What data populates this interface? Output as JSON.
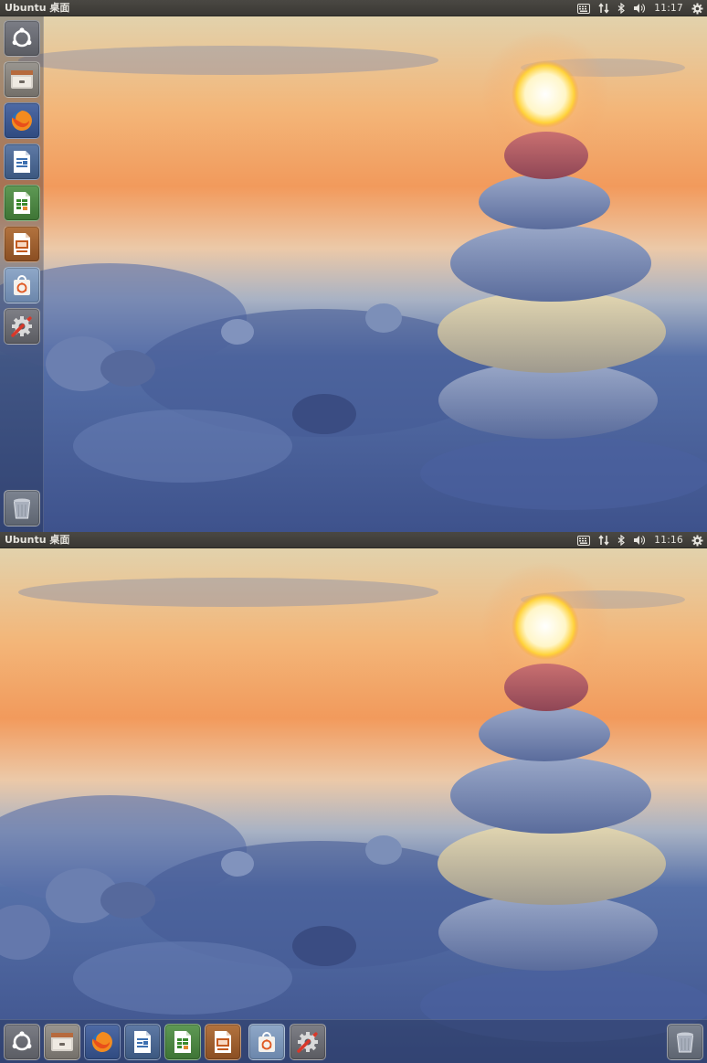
{
  "screens": [
    {
      "id": "top",
      "panel": {
        "title": "Ubuntu 桌面",
        "clock": "11:17",
        "indicators": [
          "keyboard-icon",
          "network-icon",
          "bluetooth-icon",
          "volume-icon",
          "clock",
          "settings-gear-icon"
        ]
      },
      "launcher": {
        "position": "left",
        "items": [
          "dash-home-icon",
          "files-icon",
          "firefox-icon",
          "libreoffice-writer-icon",
          "libreoffice-calc-icon",
          "libreoffice-impress-icon",
          "ubuntu-software-icon",
          "system-settings-icon"
        ],
        "trash": "trash-icon"
      }
    },
    {
      "id": "bottom",
      "panel": {
        "title": "Ubuntu 桌面",
        "clock": "11:16",
        "indicators": [
          "keyboard-icon",
          "network-icon",
          "bluetooth-icon",
          "volume-icon",
          "clock",
          "settings-gear-icon"
        ]
      },
      "launcher": {
        "position": "bottom",
        "items": [
          "dash-home-icon",
          "files-icon",
          "firefox-icon",
          "libreoffice-writer-icon",
          "libreoffice-calc-icon",
          "libreoffice-impress-icon",
          "ubuntu-software-icon",
          "system-settings-icon"
        ],
        "trash": "trash-icon"
      }
    }
  ],
  "wallpaper": {
    "subject": "stacked pebbles at sunset",
    "colors": {
      "sky_top": "#e8d3a8",
      "sky_orange": "#f49a5a",
      "horizon": "#e6dbc6",
      "beach": "#4d67a4",
      "sun": "#fff6c8",
      "stone_red": "#b85a5c",
      "stone_blue": "#7c8fb8",
      "stone_sand": "#d1c6a2"
    }
  }
}
